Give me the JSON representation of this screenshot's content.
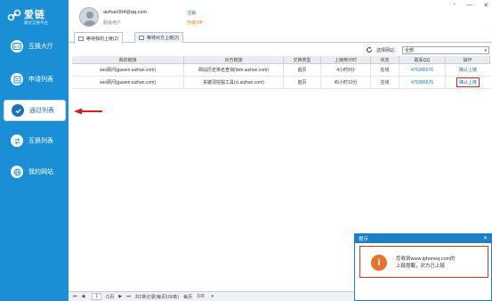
{
  "app": {
    "name": "爱链",
    "tagline": "最优交换平台",
    "logo_mark": "link-logo-icon"
  },
  "sidebar": {
    "items": [
      {
        "label": "互换大厅",
        "icon": "exchange-hall-icon",
        "active": false
      },
      {
        "label": "申请列表",
        "icon": "apply-list-icon",
        "active": false
      },
      {
        "label": "通过列表",
        "icon": "checkmark-icon",
        "active": true
      },
      {
        "label": "互换列表",
        "icon": "swap-list-icon",
        "active": false
      },
      {
        "label": "我的网站",
        "icon": "globe-icon",
        "active": false
      }
    ]
  },
  "user": {
    "email": "aizhan004@qq.com",
    "level": "超级用户",
    "logout": "注销",
    "vip": "升级VIP"
  },
  "window": {
    "pin": "ᐩ",
    "minimize": "—",
    "close": "✕"
  },
  "tabs": [
    {
      "label": "等待我的上链(2)",
      "active": true
    },
    {
      "label": "等待对方上链(2)",
      "active": false
    }
  ],
  "filter": {
    "label": "选择网站：",
    "selected": "全部"
  },
  "table": {
    "headers": [
      "我的链接",
      "对方链接",
      "交换类型",
      "上链倒计时",
      "状态",
      "联系QQ",
      "操作"
    ],
    "rows": [
      [
        "seo顾问(guwen.aizhan.com)",
        "网站历史排名查询(lishi.aizhan.com)",
        "首页",
        "4小时9分",
        "在线",
        "475285576",
        "确认上链"
      ],
      [
        "seo顾问(guwen.aizhan.com)",
        "关键词挖掘工具(ci.aizhan.com)",
        "首页",
        "45小时10分",
        "在线",
        "475285576",
        "确认上链"
      ]
    ]
  },
  "pagination": {
    "first": "⏮",
    "prev": "◀",
    "page": "1",
    "of_pages": "/1页",
    "next": "▶",
    "last": "⏭",
    "summary": "共2条记录(每页100条)",
    "per_page_label": "每页",
    "per_page": "100",
    "per_page_arrow": "▾"
  },
  "popup": {
    "title": "提示",
    "close": "✕",
    "message_line1": "您收到www.iphoneq.com的",
    "message_line2": "上链提醒，对方已上链",
    "icon": "info-icon",
    "icon_glyph": "i"
  },
  "colors": {
    "sidebar": "#1a8fd6",
    "accent": "#1a72b8",
    "highlight": "#d62020",
    "popup_head": "#1b7fc4"
  }
}
